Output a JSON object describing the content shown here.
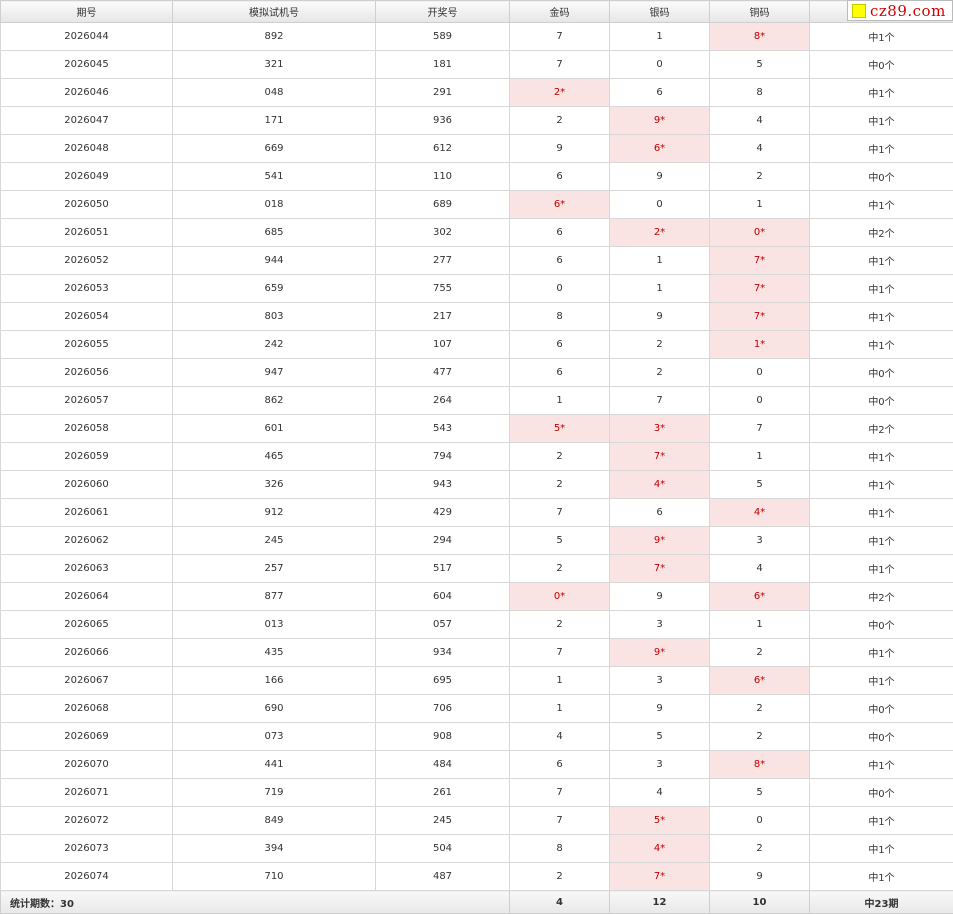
{
  "headers": [
    "期号",
    "模拟试机号",
    "开奖号",
    "金码",
    "银码",
    "铜码",
    ""
  ],
  "hit_marker": "*",
  "rows": [
    {
      "issue": "2026044",
      "trial": "892",
      "draw": "589",
      "gold": "7",
      "silver": "1",
      "bronze": "8*",
      "result": "中1个"
    },
    {
      "issue": "2026045",
      "trial": "321",
      "draw": "181",
      "gold": "7",
      "silver": "0",
      "bronze": "5",
      "result": "中0个"
    },
    {
      "issue": "2026046",
      "trial": "048",
      "draw": "291",
      "gold": "2*",
      "silver": "6",
      "bronze": "8",
      "result": "中1个"
    },
    {
      "issue": "2026047",
      "trial": "171",
      "draw": "936",
      "gold": "2",
      "silver": "9*",
      "bronze": "4",
      "result": "中1个"
    },
    {
      "issue": "2026048",
      "trial": "669",
      "draw": "612",
      "gold": "9",
      "silver": "6*",
      "bronze": "4",
      "result": "中1个"
    },
    {
      "issue": "2026049",
      "trial": "541",
      "draw": "110",
      "gold": "6",
      "silver": "9",
      "bronze": "2",
      "result": "中0个"
    },
    {
      "issue": "2026050",
      "trial": "018",
      "draw": "689",
      "gold": "6*",
      "silver": "0",
      "bronze": "1",
      "result": "中1个"
    },
    {
      "issue": "2026051",
      "trial": "685",
      "draw": "302",
      "gold": "6",
      "silver": "2*",
      "bronze": "0*",
      "result": "中2个"
    },
    {
      "issue": "2026052",
      "trial": "944",
      "draw": "277",
      "gold": "6",
      "silver": "1",
      "bronze": "7*",
      "result": "中1个"
    },
    {
      "issue": "2026053",
      "trial": "659",
      "draw": "755",
      "gold": "0",
      "silver": "1",
      "bronze": "7*",
      "result": "中1个"
    },
    {
      "issue": "2026054",
      "trial": "803",
      "draw": "217",
      "gold": "8",
      "silver": "9",
      "bronze": "7*",
      "result": "中1个"
    },
    {
      "issue": "2026055",
      "trial": "242",
      "draw": "107",
      "gold": "6",
      "silver": "2",
      "bronze": "1*",
      "result": "中1个"
    },
    {
      "issue": "2026056",
      "trial": "947",
      "draw": "477",
      "gold": "6",
      "silver": "2",
      "bronze": "0",
      "result": "中0个"
    },
    {
      "issue": "2026057",
      "trial": "862",
      "draw": "264",
      "gold": "1",
      "silver": "7",
      "bronze": "0",
      "result": "中0个"
    },
    {
      "issue": "2026058",
      "trial": "601",
      "draw": "543",
      "gold": "5*",
      "silver": "3*",
      "bronze": "7",
      "result": "中2个"
    },
    {
      "issue": "2026059",
      "trial": "465",
      "draw": "794",
      "gold": "2",
      "silver": "7*",
      "bronze": "1",
      "result": "中1个"
    },
    {
      "issue": "2026060",
      "trial": "326",
      "draw": "943",
      "gold": "2",
      "silver": "4*",
      "bronze": "5",
      "result": "中1个"
    },
    {
      "issue": "2026061",
      "trial": "912",
      "draw": "429",
      "gold": "7",
      "silver": "6",
      "bronze": "4*",
      "result": "中1个"
    },
    {
      "issue": "2026062",
      "trial": "245",
      "draw": "294",
      "gold": "5",
      "silver": "9*",
      "bronze": "3",
      "result": "中1个"
    },
    {
      "issue": "2026063",
      "trial": "257",
      "draw": "517",
      "gold": "2",
      "silver": "7*",
      "bronze": "4",
      "result": "中1个"
    },
    {
      "issue": "2026064",
      "trial": "877",
      "draw": "604",
      "gold": "0*",
      "silver": "9",
      "bronze": "6*",
      "result": "中2个"
    },
    {
      "issue": "2026065",
      "trial": "013",
      "draw": "057",
      "gold": "2",
      "silver": "3",
      "bronze": "1",
      "result": "中0个"
    },
    {
      "issue": "2026066",
      "trial": "435",
      "draw": "934",
      "gold": "7",
      "silver": "9*",
      "bronze": "2",
      "result": "中1个"
    },
    {
      "issue": "2026067",
      "trial": "166",
      "draw": "695",
      "gold": "1",
      "silver": "3",
      "bronze": "6*",
      "result": "中1个"
    },
    {
      "issue": "2026068",
      "trial": "690",
      "draw": "706",
      "gold": "1",
      "silver": "9",
      "bronze": "2",
      "result": "中0个"
    },
    {
      "issue": "2026069",
      "trial": "073",
      "draw": "908",
      "gold": "4",
      "silver": "5",
      "bronze": "2",
      "result": "中0个"
    },
    {
      "issue": "2026070",
      "trial": "441",
      "draw": "484",
      "gold": "6",
      "silver": "3",
      "bronze": "8*",
      "result": "中1个"
    },
    {
      "issue": "2026071",
      "trial": "719",
      "draw": "261",
      "gold": "7",
      "silver": "4",
      "bronze": "5",
      "result": "中0个"
    },
    {
      "issue": "2026072",
      "trial": "849",
      "draw": "245",
      "gold": "7",
      "silver": "5*",
      "bronze": "0",
      "result": "中1个"
    },
    {
      "issue": "2026073",
      "trial": "394",
      "draw": "504",
      "gold": "8",
      "silver": "4*",
      "bronze": "2",
      "result": "中1个"
    },
    {
      "issue": "2026074",
      "trial": "710",
      "draw": "487",
      "gold": "2",
      "silver": "7*",
      "bronze": "9",
      "result": "中1个"
    }
  ],
  "footer": {
    "label": "统计期数：30",
    "gold_total": "4",
    "silver_total": "12",
    "bronze_total": "10",
    "result_total": "中23期"
  },
  "watermark": {
    "text": "cz89.com",
    "icon": "yellow-square-logo",
    "color": "#d40000"
  },
  "colors": {
    "hit_bg": "#f9e3e3",
    "hit_text": "#c00000",
    "header_bg": "#e6e6e6",
    "border": "#d8d8d8"
  }
}
